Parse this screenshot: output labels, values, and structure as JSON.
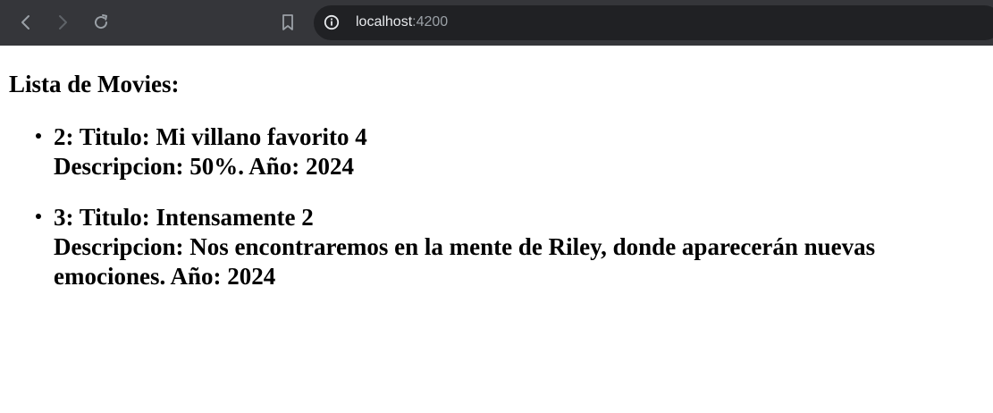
{
  "browser": {
    "url_host": "localhost",
    "url_port": ":4200",
    "icons": {
      "back": "back-arrow-icon",
      "forward": "forward-arrow-icon",
      "reload": "reload-icon",
      "bookmark": "bookmark-icon",
      "site_info": "info-icon"
    }
  },
  "page": {
    "heading": "Lista de Movies:",
    "movies": [
      {
        "line1": "2: Titulo: Mi villano favorito 4",
        "line2": "Descripcion: 50%. Año: 2024"
      },
      {
        "line1": "3: Titulo: Intensamente 2",
        "line2": "Descripcion: Nos encontraremos en la mente de Riley, donde aparecerán nuevas emociones. Año: 2024"
      }
    ]
  }
}
